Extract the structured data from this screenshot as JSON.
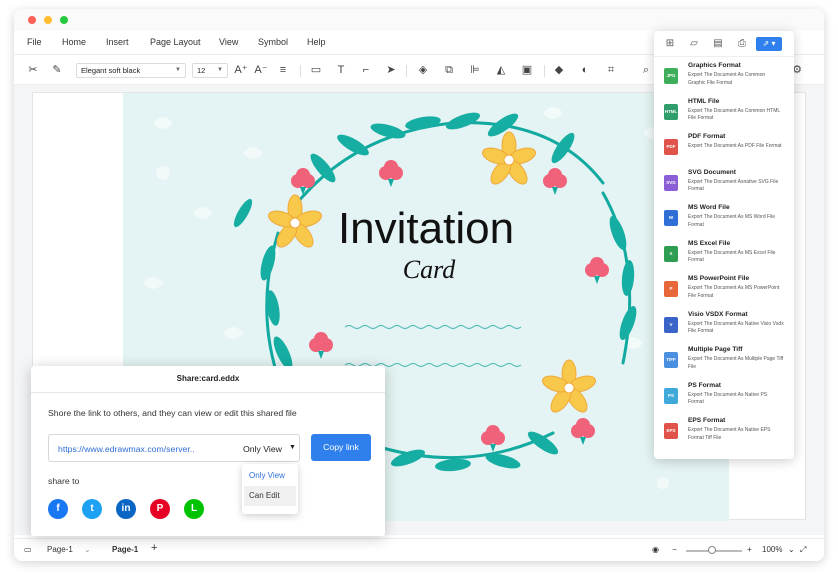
{
  "menu": [
    "File",
    "Home",
    "Insert",
    "Page Layout",
    "View",
    "Symbol",
    "Help"
  ],
  "toolbar": {
    "font": "Elegant soft black",
    "font_size": "12",
    "icons": [
      "cut-icon",
      "format-painter-icon",
      "font-grow-icon",
      "font-shrink-icon",
      "align-icon",
      "rectangle-icon",
      "text-icon",
      "connector-icon",
      "pointer-icon",
      "layers-icon",
      "group-icon",
      "align-left-icon",
      "flip-icon",
      "fit-icon",
      "fill-color-icon",
      "line-color-icon",
      "crop-icon",
      "search-icon"
    ]
  },
  "card": {
    "title": "Invitation",
    "subtitle": "Card"
  },
  "export_panel": {
    "top_icons": [
      "new-icon",
      "open-icon",
      "save-icon",
      "print-icon",
      "export-icon"
    ],
    "items": [
      {
        "title": "Graphics Format",
        "desc": "Export The Document As Common Graphic File Format",
        "badge": "JPG",
        "color": "#3fae5a"
      },
      {
        "title": "HTML File",
        "desc": "Export The Document As Common HTML File Format",
        "badge": "HTML",
        "color": "#2f9e6a"
      },
      {
        "title": "PDF Format",
        "desc": "Export The Document As PDF File Format",
        "badge": "PDF",
        "color": "#e0534a"
      },
      {
        "title": "SVG Document",
        "desc": "Export The Document Asnative SVG File Format",
        "badge": "SVG",
        "color": "#8a5fd6"
      },
      {
        "title": "MS Word File",
        "desc": "Export The Document As MS Word File Format",
        "badge": "W",
        "color": "#2f6fd6"
      },
      {
        "title": "MS Excel File",
        "desc": "Export The Document As MS Excel File Format",
        "badge": "X",
        "color": "#2e9e52"
      },
      {
        "title": "MS PowerPoint File",
        "desc": "Export The Document As MS PowerPoint File Format",
        "badge": "P",
        "color": "#e8673a"
      },
      {
        "title": "Visio VSDX Format",
        "desc": "Export The Document As Native Visio Vsdx File Format",
        "badge": "V",
        "color": "#3a64c8"
      },
      {
        "title": "Multiple Page Tiff",
        "desc": "Export The Document As Multiple Page Tiff File",
        "badge": "TIFF",
        "color": "#4a8fe0"
      },
      {
        "title": "PS Format",
        "desc": "Export The Document As Native PS Format",
        "badge": "PS",
        "color": "#3fa9d9"
      },
      {
        "title": "EPS Format",
        "desc": "Export The Document As Native EPS Format Tiff File",
        "badge": "EPS",
        "color": "#e0534a"
      }
    ]
  },
  "share": {
    "title": "Share:card.eddx",
    "description": "Shore the link to others, and they can view or edit this shared file",
    "url": "https://www.edrawmax.com/server..",
    "permission": "Only View",
    "copy_label": "Copy link",
    "share_to": "share to",
    "options": [
      "Only View",
      "Can Edit"
    ],
    "social": [
      {
        "name": "facebook-icon",
        "glyph": "f",
        "color": "#1877f2"
      },
      {
        "name": "twitter-icon",
        "glyph": "t",
        "color": "#1da1f2"
      },
      {
        "name": "linkedin-icon",
        "glyph": "in",
        "color": "#0a66c2"
      },
      {
        "name": "pinterest-icon",
        "glyph": "P",
        "color": "#e60023"
      },
      {
        "name": "line-icon",
        "glyph": "L",
        "color": "#00c300"
      }
    ]
  },
  "statusbar": {
    "page_select": "Page-1",
    "page_tab": "Page-1",
    "add": "+",
    "zoom": "100%"
  }
}
